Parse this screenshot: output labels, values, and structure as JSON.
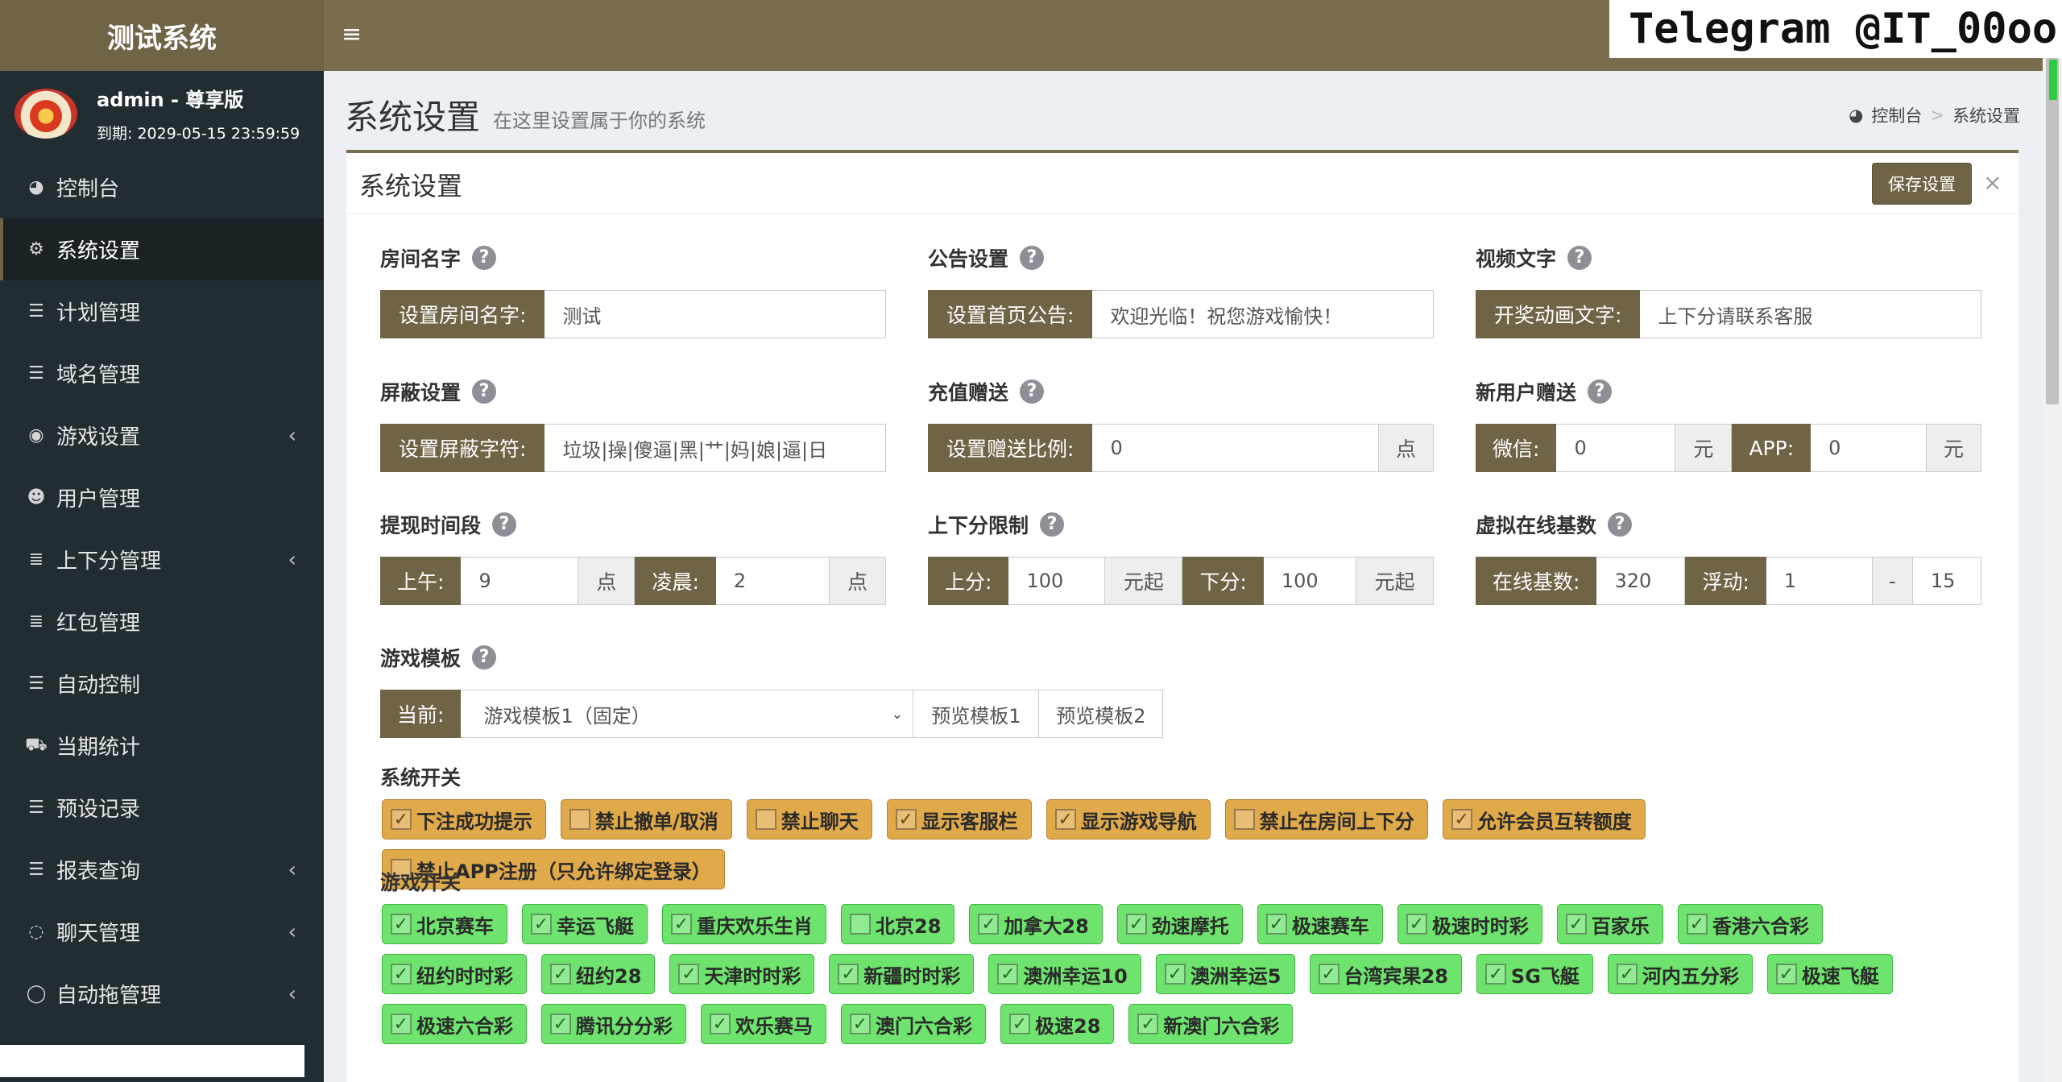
{
  "app": {
    "title": "测试系统",
    "watermark": "Telegram @IT_00oo"
  },
  "user": {
    "name": "admin - 尊享版",
    "expiry": "到期: 2029-05-15 23:59:59"
  },
  "sidebar": {
    "items": [
      {
        "label": "控制台",
        "icon": "dashboard-icon",
        "glyph": "◕",
        "chevron": ""
      },
      {
        "label": "系统设置",
        "icon": "cogs-icon",
        "glyph": "⚙",
        "chevron": ""
      },
      {
        "label": "计划管理",
        "icon": "list-icon",
        "glyph": "☰",
        "chevron": ""
      },
      {
        "label": "域名管理",
        "icon": "list-icon",
        "glyph": "☰",
        "chevron": ""
      },
      {
        "label": "游戏设置",
        "icon": "gamepad-icon",
        "glyph": "◉",
        "chevron": "‹"
      },
      {
        "label": "用户管理",
        "icon": "users-icon",
        "glyph": "☻",
        "chevron": ""
      },
      {
        "label": "上下分管理",
        "icon": "database-icon",
        "glyph": "≣",
        "chevron": "‹"
      },
      {
        "label": "红包管理",
        "icon": "database-icon",
        "glyph": "≣",
        "chevron": ""
      },
      {
        "label": "自动控制",
        "icon": "list-icon",
        "glyph": "☰",
        "chevron": ""
      },
      {
        "label": "当期统计",
        "icon": "cart-icon",
        "glyph": "⛟",
        "chevron": ""
      },
      {
        "label": "预设记录",
        "icon": "list-icon",
        "glyph": "☰",
        "chevron": ""
      },
      {
        "label": "报表查询",
        "icon": "list-icon",
        "glyph": "☰",
        "chevron": "‹"
      },
      {
        "label": "聊天管理",
        "icon": "comments-icon",
        "glyph": "◌",
        "chevron": "‹"
      },
      {
        "label": "自动拖管理",
        "icon": "comment-icon",
        "glyph": "◯",
        "chevron": "‹"
      }
    ]
  },
  "header": {
    "title": "系统设置",
    "subtitle": "在这里设置属于你的系统",
    "breadcrumb_home": "控制台",
    "breadcrumb_sep": ">",
    "breadcrumb_current": "系统设置"
  },
  "box": {
    "title": "系统设置",
    "save_label": "保存设置",
    "close": "×"
  },
  "help": "?",
  "room": {
    "label": "房间名字",
    "addon": "设置房间名字:",
    "value": "测试"
  },
  "notice": {
    "label": "公告设置",
    "addon": "设置首页公告:",
    "value": "欢迎光临！祝您游戏愉快！"
  },
  "video": {
    "label": "视频文字",
    "addon": "开奖动画文字:",
    "value": "上下分请联系客服"
  },
  "block": {
    "label": "屏蔽设置",
    "addon": "设置屏蔽字符:",
    "value": "垃圾|操|傻逼|黑|艹|妈|娘|逼|日"
  },
  "recharge": {
    "label": "充值赠送",
    "addon": "设置赠送比例:",
    "value": "0",
    "unit": "点"
  },
  "newuser": {
    "label": "新用户赠送",
    "wechat_addon": "微信:",
    "wechat_value": "0",
    "unit": "元",
    "app_addon": "APP:",
    "app_value": "0"
  },
  "withdraw": {
    "label": "提现时间段",
    "am_addon": "上午:",
    "am_value": "9",
    "unit": "点",
    "night_addon": "凌晨:",
    "night_value": "2"
  },
  "limit": {
    "label": "上下分限制",
    "up_addon": "上分:",
    "up_value": "100",
    "unit": "元起",
    "down_addon": "下分:",
    "down_value": "100"
  },
  "online": {
    "label": "虚拟在线基数",
    "base_addon": "在线基数:",
    "base_value": "320",
    "float_addon": "浮动:",
    "float_min": "1",
    "dash": "-",
    "float_max": "15"
  },
  "template": {
    "label": "游戏模板",
    "addon": "当前:",
    "selected": "游戏模板1（固定）",
    "caret": "⌄",
    "preview1": "预览模板1",
    "preview2": "预览模板2"
  },
  "system_switches": {
    "label": "系统开关",
    "items": [
      {
        "label": "下注成功提示",
        "checked": true
      },
      {
        "label": "禁止撤单/取消",
        "checked": false
      },
      {
        "label": "禁止聊天",
        "checked": false
      },
      {
        "label": "显示客服栏",
        "checked": true
      },
      {
        "label": "显示游戏导航",
        "checked": true
      },
      {
        "label": "禁止在房间上下分",
        "checked": false
      },
      {
        "label": "允许会员互转额度",
        "checked": true
      },
      {
        "label": "禁止APP注册（只允许绑定登录）",
        "checked": false
      }
    ]
  },
  "game_switches": {
    "label": "游戏开关",
    "items": [
      {
        "label": "北京赛车",
        "checked": true
      },
      {
        "label": "幸运飞艇",
        "checked": true
      },
      {
        "label": "重庆欢乐生肖",
        "checked": true
      },
      {
        "label": "北京28",
        "checked": false
      },
      {
        "label": "加拿大28",
        "checked": true
      },
      {
        "label": "劲速摩托",
        "checked": true
      },
      {
        "label": "极速赛车",
        "checked": true
      },
      {
        "label": "极速时时彩",
        "checked": true
      },
      {
        "label": "百家乐",
        "checked": true
      },
      {
        "label": "香港六合彩",
        "checked": true
      },
      {
        "label": "纽约时时彩",
        "checked": true
      },
      {
        "label": "纽约28",
        "checked": true
      },
      {
        "label": "天津时时彩",
        "checked": true
      },
      {
        "label": "新疆时时彩",
        "checked": true
      },
      {
        "label": "澳洲幸运10",
        "checked": true
      },
      {
        "label": "澳洲幸运5",
        "checked": true
      },
      {
        "label": "台湾宾果28",
        "checked": true
      },
      {
        "label": "SG飞艇",
        "checked": true
      },
      {
        "label": "河内五分彩",
        "checked": true
      },
      {
        "label": "极速飞艇",
        "checked": true
      },
      {
        "label": "极速六合彩",
        "checked": true
      },
      {
        "label": "腾讯分分彩",
        "checked": true
      },
      {
        "label": "欢乐赛马",
        "checked": true
      },
      {
        "label": "澳门六合彩",
        "checked": true
      },
      {
        "label": "极速28",
        "checked": true
      },
      {
        "label": "新澳门六合彩",
        "checked": true
      }
    ]
  },
  "check_glyph": "✓",
  "colors": {
    "accent": "#6f6446",
    "sidebar": "#222d32",
    "sys_toggle": "#e0a94a",
    "game_toggle": "#6ee46e"
  }
}
